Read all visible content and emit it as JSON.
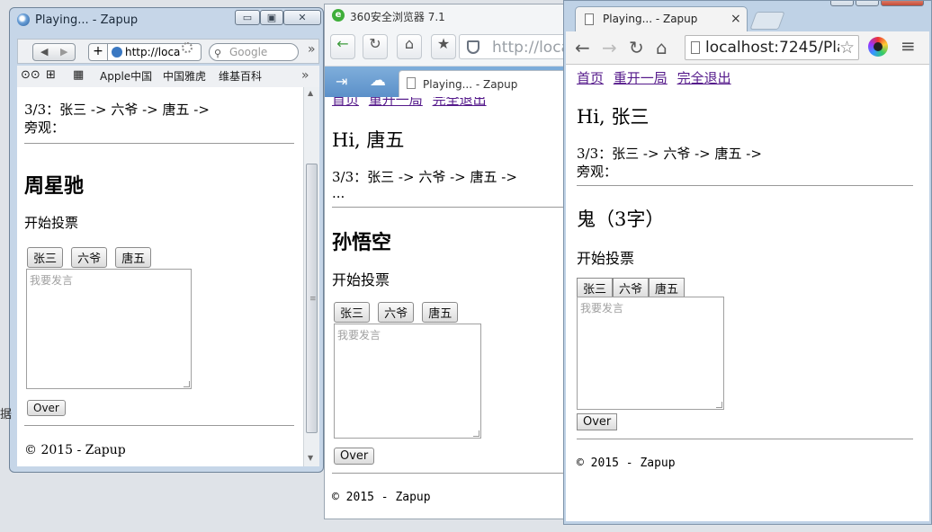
{
  "win1": {
    "title": "Playing... - Zapup",
    "caption_min": "▭",
    "caption_max": "▣",
    "caption_close": "✕",
    "url": "http://loca",
    "search_placeholder": "Google",
    "bookmarks": [
      "Apple中国",
      "中国雅虎",
      "维基百科"
    ],
    "more": "»",
    "page": {
      "progress": "3/3：张三 -> 六爷 -> 唐五 ->",
      "spectators": "旁观：",
      "player_name": "周星驰",
      "status": "开始投票",
      "vote_buttons": [
        "张三",
        "六爷",
        "唐五"
      ],
      "speech_placeholder": "我要发言",
      "over_button": "Over",
      "footer": "© 2015 - Zapup"
    }
  },
  "win2": {
    "title": "360安全浏览器 7.1",
    "url": "http://loca",
    "tab_title": "Playing... - Zapup",
    "page": {
      "nav_home": "首页",
      "nav_restart": "重开一局",
      "nav_quit": "完全退出",
      "greeting": "Hi, 唐五",
      "progress": "3/3：张三 -> 六爷 -> 唐五 ->",
      "spectators": "...",
      "player_name": "孙悟空",
      "status": "开始投票",
      "vote_buttons": [
        "张三",
        "六爷",
        "唐五"
      ],
      "speech_placeholder": "我要发言",
      "over_button": "Over",
      "footer": "© 2015 - Zapup"
    }
  },
  "win3": {
    "tab_title": "Playing... - Zapup",
    "tab_close": "×",
    "url": "localhost:7245/Play",
    "page": {
      "nav_home": "首页",
      "nav_restart": "重开一局",
      "nav_quit": "完全退出",
      "greeting": "Hi, 张三",
      "progress": "3/3：张三 -> 六爷 -> 唐五 ->",
      "spectators": "旁观：",
      "player_name": "鬼（3字）",
      "status": "开始投票",
      "vote_buttons": [
        "张三",
        "六爷",
        "唐五"
      ],
      "speech_placeholder": "我要发言",
      "over_button": "Over",
      "footer": "© 2015 - Zapup"
    }
  },
  "desktop": {
    "partial_text": "据"
  }
}
